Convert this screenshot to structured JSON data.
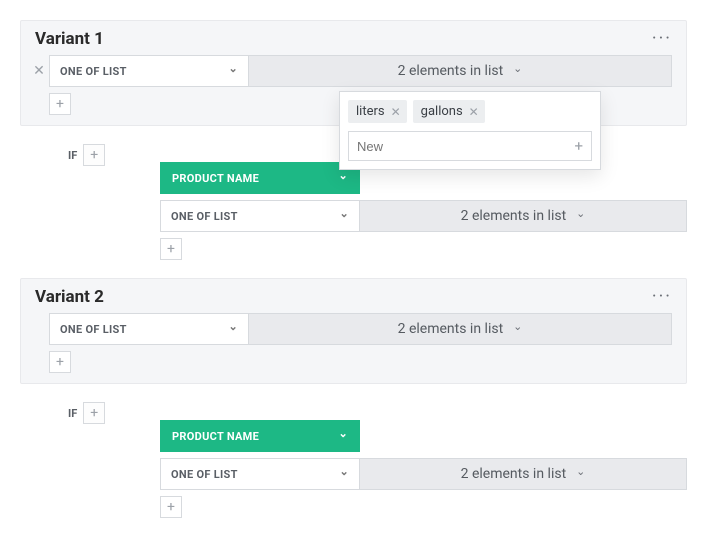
{
  "variants": [
    {
      "title": "Variant 1",
      "condition_type": "ONE OF LIST",
      "elements_summary": "2 elements in list",
      "if_label": "IF",
      "product_label": "PRODUCT NAME",
      "nested_condition_type": "ONE OF LIST",
      "nested_elements_summary": "2 elements in list"
    },
    {
      "title": "Variant 2",
      "condition_type": "ONE OF LIST",
      "elements_summary": "2 elements in list",
      "if_label": "IF",
      "product_label": "PRODUCT NAME",
      "nested_condition_type": "ONE OF LIST",
      "nested_elements_summary": "2 elements in list"
    }
  ],
  "popover": {
    "tags": [
      "liters",
      "gallons"
    ],
    "new_placeholder": "New"
  }
}
